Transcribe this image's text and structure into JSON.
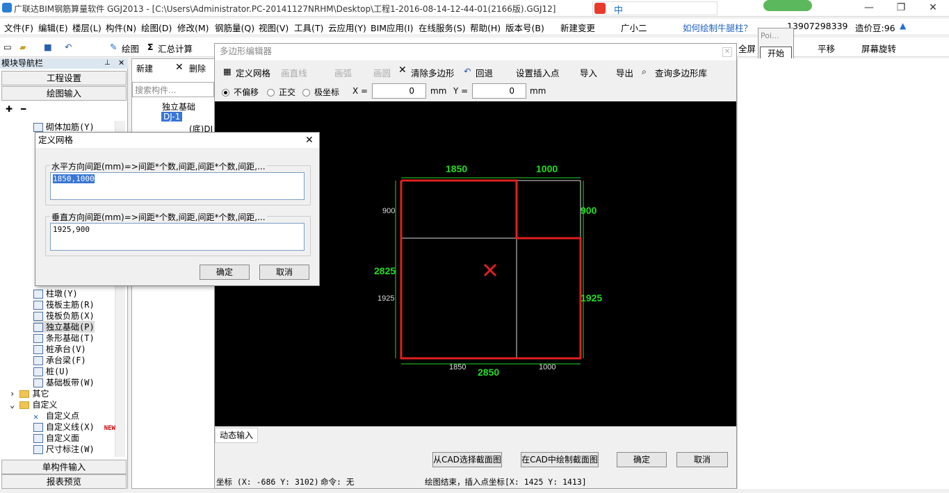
{
  "app": {
    "title": "广联达BIM钢筋算量软件 GGJ2013 - [C:\\Users\\Administrator.PC-20141127NRHM\\Desktop\\工程1-2016-08-14-12-44-01(2166版).GGJ12]",
    "ime": "中"
  },
  "menu": [
    "文件(F)",
    "编辑(E)",
    "楼层(L)",
    "构件(N)",
    "绘图(D)",
    "修改(M)",
    "钢筋量(Q)",
    "视图(V)",
    "工具(T)",
    "云应用(Y)",
    "BIM应用(I)",
    "在线服务(S)",
    "帮助(H)",
    "版本号(B)",
    "新建变更",
    "广小二"
  ],
  "menu_right": {
    "help_link": "如何绘制牛腿柱？",
    "phone": "13907298339",
    "cost": "造价豆:96"
  },
  "toolbar": {
    "draw": "绘图",
    "sum": "汇总计算",
    "fullscreen": "全屏",
    "pan": "平移",
    "rotate": "屏幕旋转"
  },
  "popup": {
    "title": "Poi...",
    "start": "开始"
  },
  "nav": {
    "title": "模块导航栏",
    "project_settings": "工程设置",
    "drawing_input": "绘图输入",
    "single_input": "单构件输入",
    "report_preview": "报表预览",
    "items": [
      "砌体加筋(Y)",
      "柱墩(Y)",
      "筏板主筋(R)",
      "筏板负筋(X)",
      "独立基础(P)",
      "条形基础(T)",
      "桩承台(V)",
      "承台梁(F)",
      "桩(U)",
      "基础板带(W)",
      "其它",
      "自定义",
      "自定义点",
      "自定义线(X)",
      "自定义面",
      "尺寸标注(W)"
    ],
    "new_badge": "NEW"
  },
  "mid": {
    "new": "新建",
    "delete": "删除",
    "search_placeholder": "搜索构件...",
    "tree": [
      "独立基础",
      "DJ-1",
      "(底)DJ"
    ]
  },
  "grid_dialog": {
    "title": "定义网格",
    "h_label": "水平方向间距(mm)=>间距*个数,间距,间距*个数,间距,...",
    "h_value": "1850,1000",
    "v_label": "垂直方向间距(mm)=>间距*个数,间距,间距*个数,间距,...",
    "v_value": "1925,900",
    "ok": "确定",
    "cancel": "取消"
  },
  "poly_editor": {
    "title": "多边形编辑器",
    "tools": [
      "定义网格",
      "画直线",
      "画弧",
      "画圆",
      "清除多边形",
      "回退",
      "设置插入点",
      "导入",
      "导出",
      "查询多边形库"
    ],
    "radios": [
      "不偏移",
      "正交",
      "极坐标"
    ],
    "x_label": "X =",
    "x_value": "0",
    "y_label": "Y =",
    "y_value": "0",
    "unit": "mm",
    "dim_labels": {
      "top1": "1850",
      "top2": "1000",
      "left_top": "900",
      "right_top": "900",
      "left_total": "2825",
      "left_bottom": "1925",
      "right_bottom": "1925",
      "bottom1": "1850",
      "bottom2": "1000",
      "bottom_total": "2850"
    },
    "dyn_input": "动态输入",
    "from_cad": "从CAD选择截面图",
    "draw_cad": "在CAD中绘制截面图",
    "ok": "确定",
    "cancel": "取消",
    "status_coord": "坐标 (X: -686 Y: 3102)",
    "status_cmd": "命令: 无",
    "status_msg": "绘图结束，插入点坐标[X: 1425 Y: 1413]"
  },
  "colors": {
    "poly": "#e02020",
    "dims": "#22dd22",
    "grid": "#dddddd",
    "canvas": "#000000",
    "selected": "#3875d7"
  }
}
